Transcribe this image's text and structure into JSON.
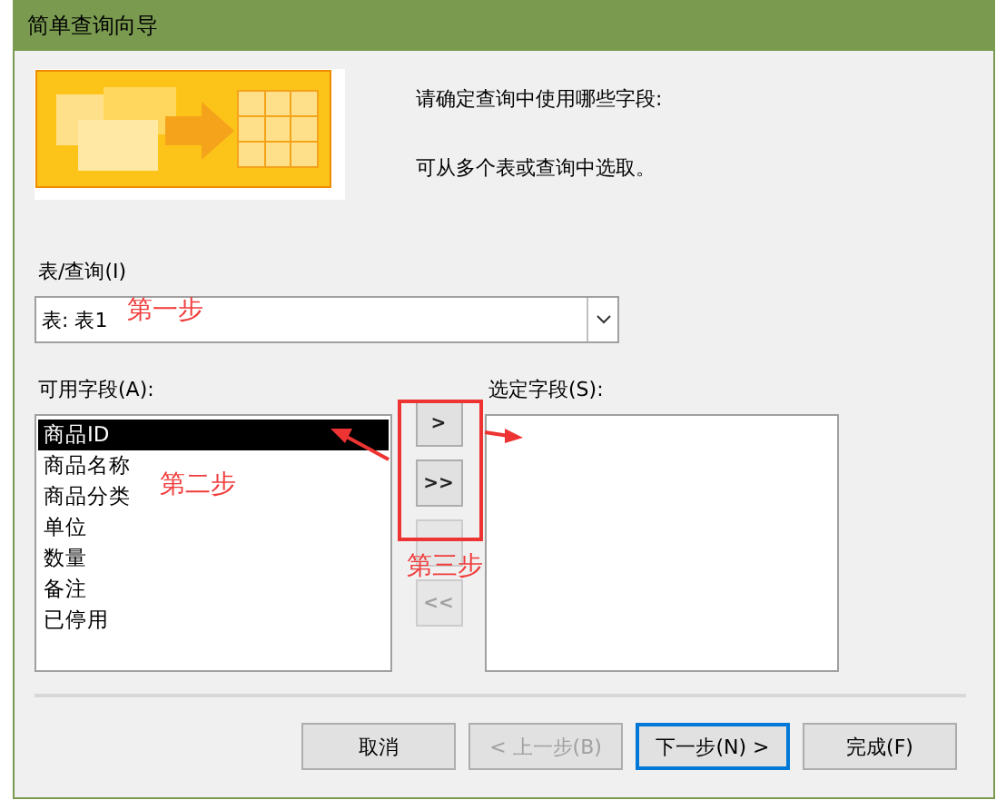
{
  "window": {
    "title": "简单查询向导"
  },
  "intro": [
    "请确定查询中使用哪些字段:",
    "可从多个表或查询中选取。"
  ],
  "table_query": {
    "label": "表/查询(I)",
    "value": "表: 表1"
  },
  "available_fields": {
    "label": "可用字段(A):",
    "items": [
      {
        "label": "商品ID",
        "selected": true
      },
      {
        "label": "商品名称",
        "selected": false
      },
      {
        "label": "商品分类",
        "selected": false
      },
      {
        "label": "单位",
        "selected": false
      },
      {
        "label": "数量",
        "selected": false
      },
      {
        "label": "备注",
        "selected": false
      },
      {
        "label": "已停用",
        "selected": false
      }
    ]
  },
  "move_buttons": [
    {
      "label": ">",
      "disabled": false
    },
    {
      "label": ">>",
      "disabled": false
    },
    {
      "disabled": true
    },
    {
      "label": "<<",
      "disabled": true
    }
  ],
  "selected_fields": {
    "label": "选定字段(S):"
  },
  "buttons": [
    {
      "label": "取消",
      "disabled": false,
      "default": false
    },
    {
      "label": "< 上一步(B)",
      "disabled": true,
      "default": false
    },
    {
      "label": "下一步(N) >",
      "disabled": false,
      "default": true
    },
    {
      "label": "完成(F)",
      "disabled": false,
      "default": false
    }
  ],
  "annotations": [
    "第一步",
    "第二步",
    "第三步"
  ]
}
